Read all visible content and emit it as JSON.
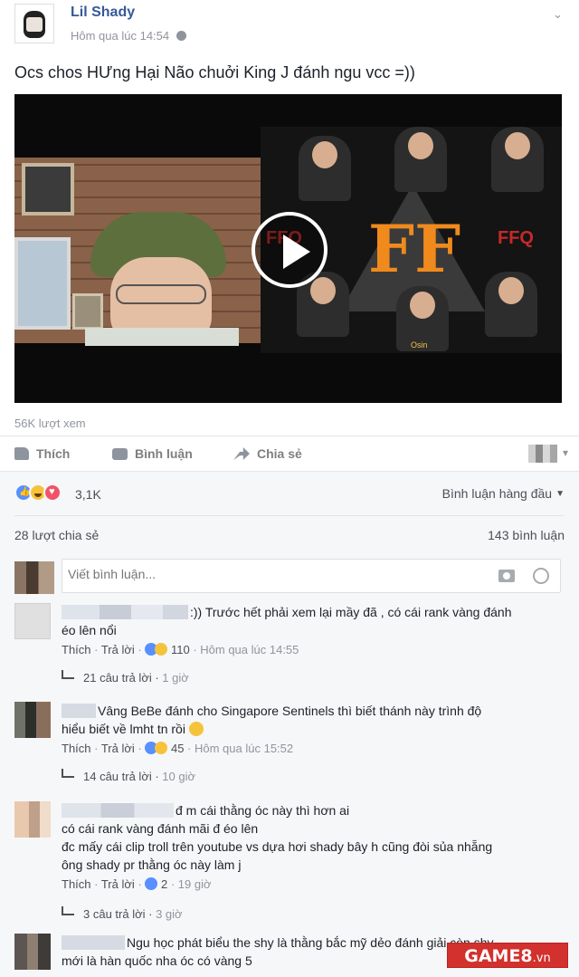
{
  "post": {
    "author": "Lil Shady",
    "timestamp": "Hôm qua lúc 14:54",
    "text": "Ocs chos HƯng Hại Não chuởi King J đánh ngu vcc =))",
    "views": "56K lượt xem",
    "video_labels": {
      "team_left": "FFQ",
      "team_right": "FFQ",
      "logo": "FF",
      "player_caption": "Osin"
    }
  },
  "actions": {
    "like": "Thích",
    "comment": "Bình luận",
    "share": "Chia sẻ"
  },
  "feedback": {
    "reaction_count": "3,1K",
    "sort_label": "Bình luận hàng đầu",
    "shares": "28 lượt chia sẻ",
    "comments": "143 bình luận",
    "composer_placeholder": "Viết bình luận..."
  },
  "comments": [
    {
      "line1": ":)) Trước hết phải xem lại mầy đã , có cái rank vàng đánh",
      "line2": "éo lên nổi",
      "like_label": "Thích",
      "reply_label": "Trả lời",
      "reaction_count": "110",
      "time": "Hôm qua lúc 14:55",
      "replies_label": "21 câu trả lời",
      "replies_time": "1 giờ"
    },
    {
      "line1": "Vâng BeBe đánh cho Singapore Sentinels thì biết thánh này trình độ",
      "line2": "hiểu biết về lmht tn rồi",
      "like_label": "Thích",
      "reply_label": "Trả lời",
      "reaction_count": "45",
      "time": "Hôm qua lúc 15:52",
      "replies_label": "14 câu trả lời",
      "replies_time": "10 giờ"
    },
    {
      "line1": "đ m cái thằng óc này thì hơn ai",
      "line2": "có cái rank vàng đánh mãi đ éo lên",
      "line3": "đc mấy cái clip troll trên youtube vs dựa hơi shady bây h cũng đòi sủa nhẵng",
      "line4": "ông shady pr thằng óc này làm j",
      "like_label": "Thích",
      "reply_label": "Trả lời",
      "reaction_count": "2",
      "time": "19 giờ",
      "replies_label": "3 câu trả lời",
      "replies_time": "3 giờ"
    },
    {
      "line1": "Ngu học phát biểu the shy là thằng bắc mỹ dẻo đánh giải còn shy",
      "line2": "mới là hàn quốc nha óc có vàng 5"
    }
  ],
  "watermark": {
    "main": "GAME8",
    "suffix": ".vn"
  },
  "colors": {
    "link": "#365899",
    "muted": "#90949c",
    "like_blue": "#5890ff",
    "haha_yellow": "#f5c33b",
    "love_red": "#f25268",
    "watermark_red": "#d2312d"
  }
}
